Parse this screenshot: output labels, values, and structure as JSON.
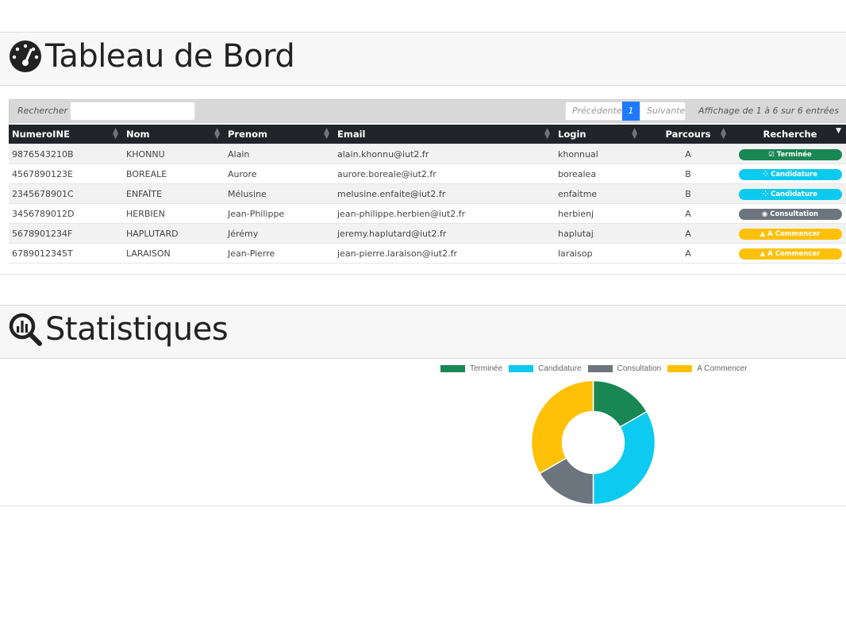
{
  "dashboard": {
    "title": "Tableau de Bord"
  },
  "table_controls": {
    "search_label": "Rechercher :",
    "search_value": "",
    "prev_label": "Précédente",
    "page": "1",
    "next_label": "Suivante",
    "info": "Affichage de 1 à 6 sur 6 entrées"
  },
  "columns": [
    "NumeroINE",
    "Nom",
    "Prenom",
    "Email",
    "Login",
    "Parcours",
    "Recherche"
  ],
  "rows": [
    {
      "ine": "9876543210B",
      "nom": "KHONNU",
      "prenom": "Alain",
      "email": "alain.khonnu@iut2.fr",
      "login": "khonnual",
      "parcours": "A",
      "status": "Terminée",
      "status_icon": "check-square-icon",
      "status_color": "#198754"
    },
    {
      "ine": "4567890123E",
      "nom": "BOREALE",
      "prenom": "Aurore",
      "email": "aurore.boreale@iut2.fr",
      "login": "borealea",
      "parcours": "B",
      "status": "Candidature",
      "status_icon": "spinner-icon",
      "status_color": "#0dcaf0"
    },
    {
      "ine": "2345678901C",
      "nom": "ENFAÏTE",
      "prenom": "Mélusine",
      "email": "melusine.enfaite@iut2.fr",
      "login": "enfaitme",
      "parcours": "B",
      "status": "Candidature",
      "status_icon": "spinner-icon",
      "status_color": "#0dcaf0"
    },
    {
      "ine": "3456789012D",
      "nom": "HERBIEN",
      "prenom": "Jean-Philippe",
      "email": "jean-philippe.herbien@iut2.fr",
      "login": "herbienj",
      "parcours": "A",
      "status": "Consultation",
      "status_icon": "eye-icon",
      "status_color": "#6c757d"
    },
    {
      "ine": "5678901234F",
      "nom": "HAPLUTARD",
      "prenom": "Jérémy",
      "email": "jeremy.haplutard@iut2.fr",
      "login": "haplutaj",
      "parcours": "A",
      "status": "A Commencer",
      "status_icon": "warning-icon",
      "status_color": "#ffc107"
    },
    {
      "ine": "6789012345T",
      "nom": "LARAISON",
      "prenom": "Jean-Pierre",
      "email": "jean-pierre.laraison@iut2.fr",
      "login": "laraisop",
      "parcours": "A",
      "status": "A Commencer",
      "status_icon": "warning-icon",
      "status_color": "#ffc107"
    }
  ],
  "statistics": {
    "title": "Statistiques"
  },
  "chart_data": {
    "type": "pie",
    "variant": "doughnut",
    "categories": [
      "Terminée",
      "Candidature",
      "Consultation",
      "A Commencer"
    ],
    "values": [
      1,
      2,
      1,
      2
    ],
    "colors": [
      "#198754",
      "#0dcaf0",
      "#6c757d",
      "#ffc107"
    ],
    "legend": "top"
  }
}
